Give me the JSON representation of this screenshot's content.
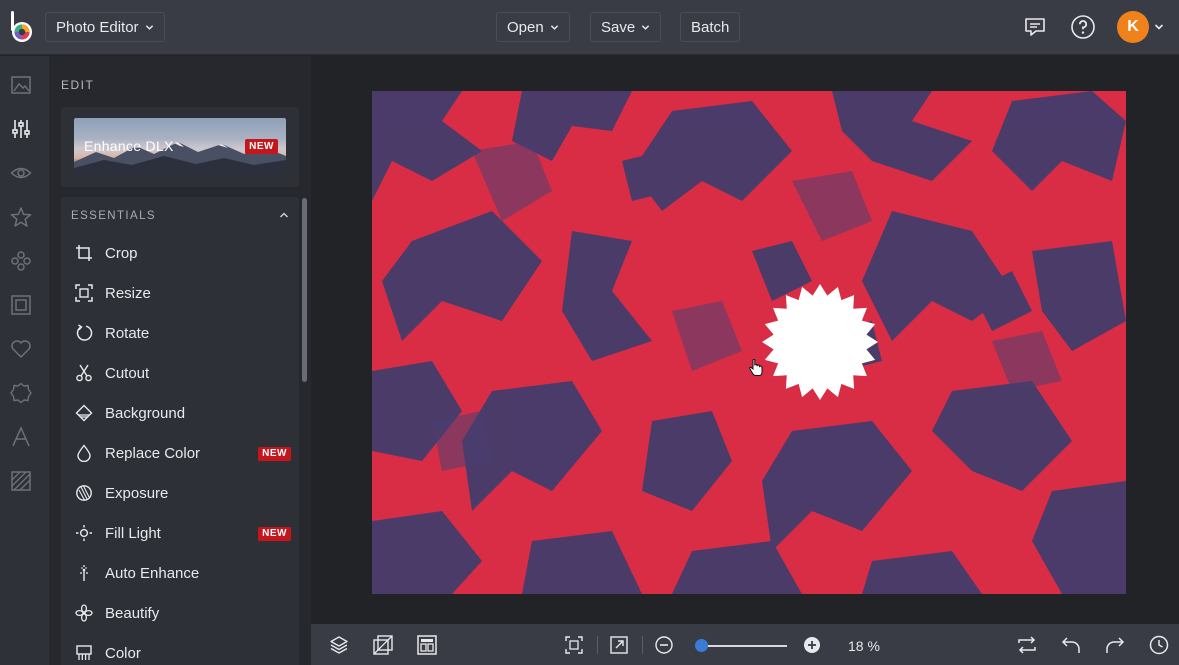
{
  "header": {
    "app_menu_label": "Photo Editor",
    "open_label": "Open",
    "save_label": "Save",
    "batch_label": "Batch",
    "avatar_initial": "K"
  },
  "panel": {
    "title": "EDIT",
    "enhance_card": {
      "label": "Enhance DLX",
      "badge": "NEW"
    },
    "section_title": "ESSENTIALS",
    "tools": [
      {
        "label": "Crop",
        "icon": "crop-icon",
        "badge": ""
      },
      {
        "label": "Resize",
        "icon": "resize-icon",
        "badge": ""
      },
      {
        "label": "Rotate",
        "icon": "rotate-icon",
        "badge": ""
      },
      {
        "label": "Cutout",
        "icon": "scissors-icon",
        "badge": ""
      },
      {
        "label": "Background",
        "icon": "background-icon",
        "badge": ""
      },
      {
        "label": "Replace Color",
        "icon": "droplet-icon",
        "badge": "NEW"
      },
      {
        "label": "Exposure",
        "icon": "exposure-icon",
        "badge": ""
      },
      {
        "label": "Fill Light",
        "icon": "light-icon",
        "badge": "NEW"
      },
      {
        "label": "Auto Enhance",
        "icon": "sparkle-icon",
        "badge": ""
      },
      {
        "label": "Beautify",
        "icon": "flower-icon",
        "badge": ""
      },
      {
        "label": "Color",
        "icon": "palette-icon",
        "badge": ""
      }
    ]
  },
  "rail": [
    "image-icon",
    "sliders-icon",
    "eye-icon",
    "star-icon",
    "graphics-icon",
    "frame-icon",
    "heart-icon",
    "badge-icon",
    "text-icon",
    "texture-icon"
  ],
  "canvas": {
    "photo_color": "#d92d45",
    "ink_color": "#3b3d6e"
  },
  "bottombar": {
    "zoom_value": "18 %",
    "zoom_fraction": 0.05
  },
  "colors": {
    "accent": "#3a7bd5",
    "badge": "#c4161c",
    "avatar": "#f0821c"
  }
}
